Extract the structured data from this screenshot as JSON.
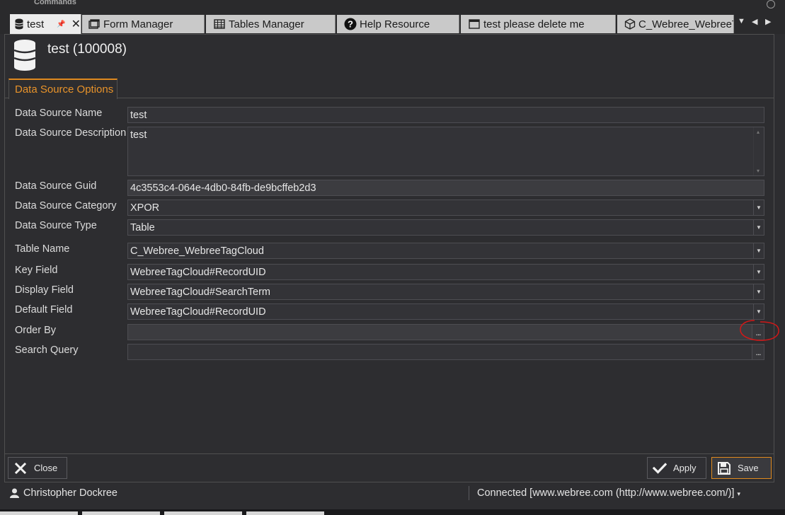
{
  "top": {
    "commands_label": "Commands"
  },
  "tabs": [
    {
      "label": "test",
      "icon": "database-icon",
      "active": true
    },
    {
      "label": "Form Manager",
      "icon": "window-icon"
    },
    {
      "label": "Tables Manager",
      "icon": "table-icon"
    },
    {
      "label": "Help Resource",
      "icon": "help-icon"
    },
    {
      "label": "test please delete me",
      "icon": "window-icon"
    },
    {
      "label": "C_Webree_WebreeT",
      "icon": "cube-icon"
    }
  ],
  "header": {
    "title": "test (100008)",
    "icon": "database-icon"
  },
  "options_tab": {
    "label": "Data Source Options",
    "accent": "#e8932a"
  },
  "form": {
    "name": {
      "label": "Data Source Name",
      "value": "test"
    },
    "description": {
      "label": "Data Source Description",
      "value": "test"
    },
    "guid": {
      "label": "Data Source Guid",
      "value": "4c3553c4-064e-4db0-84fb-de9bcffeb2d3"
    },
    "category": {
      "label": "Data Source Category",
      "value": "XPOR"
    },
    "type": {
      "label": "Data Source Type",
      "value": "Table"
    },
    "table_name": {
      "label": "Table Name",
      "value": "C_Webree_WebreeTagCloud"
    },
    "key_field": {
      "label": "Key Field",
      "value": "WebreeTagCloud#RecordUID"
    },
    "display_field": {
      "label": "Display Field",
      "value": "WebreeTagCloud#SearchTerm"
    },
    "default_field": {
      "label": "Default Field",
      "value": "WebreeTagCloud#RecordUID"
    },
    "order_by": {
      "label": "Order By",
      "value": ""
    },
    "search_query": {
      "label": "Search Query",
      "value": ""
    },
    "ellipsis": "..."
  },
  "buttons": {
    "close": "Close",
    "apply": "Apply",
    "save": "Save"
  },
  "status": {
    "user": "Christopher Dockree",
    "connection": "Connected [www.webree.com (http://www.webree.com/)]"
  }
}
